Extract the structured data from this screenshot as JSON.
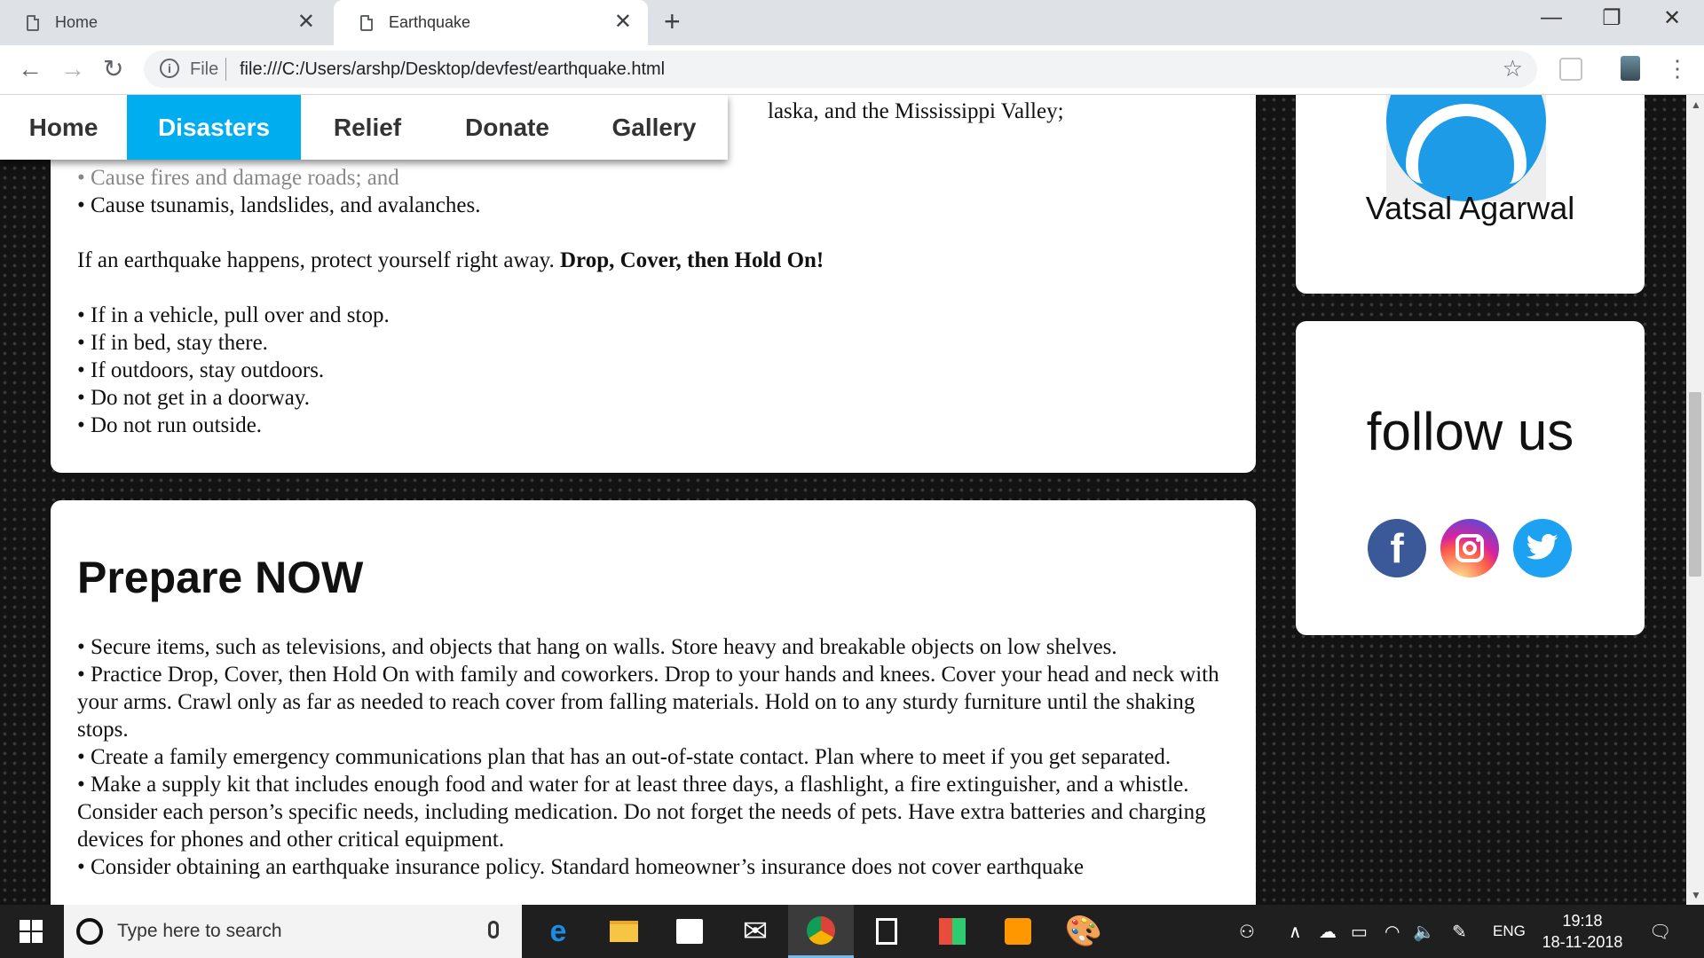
{
  "browser": {
    "tabs": [
      {
        "title": "Home"
      },
      {
        "title": "Earthquake"
      }
    ],
    "address": {
      "scheme_label": "File",
      "url": "file:///C:/Users/arshp/Desktop/devfest/earthquake.html"
    }
  },
  "nav": {
    "items": [
      {
        "label": "Home"
      },
      {
        "label": "Disasters",
        "active": true
      },
      {
        "label": "Relief"
      },
      {
        "label": "Donate"
      },
      {
        "label": "Gallery"
      }
    ]
  },
  "content": {
    "card1": {
      "top_line": "laska, and the Mississippi Valley;",
      "bullets_top": [
        "• Cause fires and damage roads; and",
        "• Cause tsunamis, landslides, and avalanches."
      ],
      "protect_text": "If an earthquake happens, protect yourself right away. ",
      "protect_bold": "Drop, Cover, then Hold On!",
      "actions": [
        "• If in a vehicle, pull over and stop.",
        "• If in bed, stay there.",
        "• If outdoors, stay outdoors.",
        "• Do not get in a doorway.",
        "• Do not run outside."
      ]
    },
    "card2": {
      "heading": "Prepare NOW",
      "bullets": [
        "• Secure items, such as televisions, and objects that hang on walls. Store heavy and breakable objects on low shelves.",
        "• Practice Drop, Cover, then Hold On with family and coworkers. Drop to your hands and knees. Cover your head and neck with your arms. Crawl only as far as needed to reach cover from falling materials. Hold on to any sturdy furniture until the shaking stops.",
        "• Create a family emergency communications plan that has an out-of-state contact. Plan where to meet if you get separated.",
        "• Make a supply kit that includes enough food and water for at least three days, a flashlight, a fire extinguisher, and a whistle. Consider each person’s specific needs, including medication. Do not forget the needs of pets. Have extra batteries and charging devices for phones and other critical equipment.",
        "• Consider obtaining an earthquake insurance policy. Standard homeowner’s insurance does not cover earthquake"
      ]
    }
  },
  "sidebar": {
    "profile_name": "Vatsal Agarwal",
    "follow_title": "follow us",
    "social": [
      {
        "icon": "facebook-icon",
        "glyph": "f",
        "color": "#3b5998"
      },
      {
        "icon": "instagram-icon",
        "color": "#d6249f"
      },
      {
        "icon": "twitter-icon",
        "color": "#1da1f2"
      }
    ]
  },
  "taskbar": {
    "search_placeholder": "Type here to search",
    "language": "ENG",
    "time": "19:18",
    "date": "18-11-2018",
    "apps": [
      "edge-icon",
      "file-explorer-icon",
      "store-icon",
      "mail-icon",
      "chrome-icon",
      "calculator-icon",
      "office-icon",
      "sublime-text-icon",
      "paint-icon"
    ]
  }
}
